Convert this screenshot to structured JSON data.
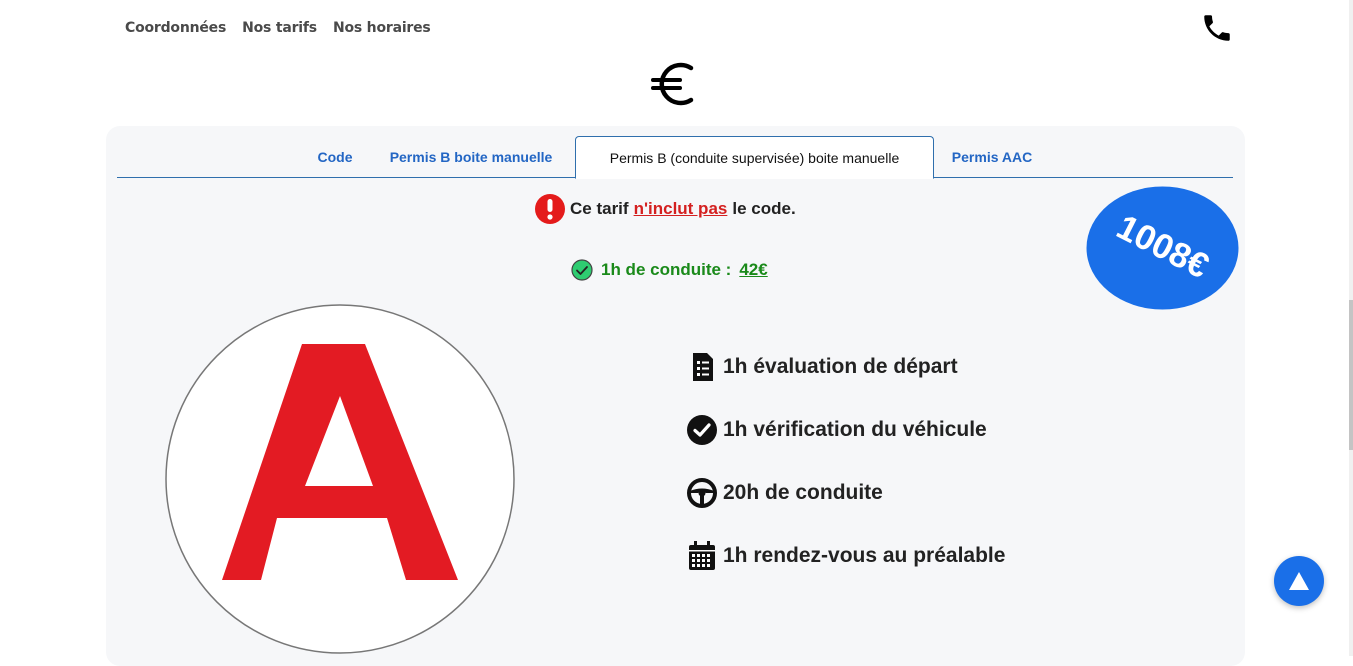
{
  "nav": {
    "items": [
      "Coordonnées",
      "Nos tarifs",
      "Nos horaires"
    ]
  },
  "header_icons": {
    "phone": "phone-icon",
    "euro": "euro-icon"
  },
  "tabs": [
    {
      "label": "Code",
      "active": false
    },
    {
      "label": "Permis B boite manuelle",
      "active": false
    },
    {
      "label": "Permis B (conduite supervisée) boite manuelle",
      "active": true
    },
    {
      "label": "Permis AAC",
      "active": false
    }
  ],
  "notice": {
    "pre": "Ce tarif",
    "highlight": "n'inclut pas",
    "post": "le code."
  },
  "hourly": {
    "label": "1h de conduite :",
    "price": "42€"
  },
  "price_badge": "1008€",
  "features": [
    {
      "icon": "checklist-icon",
      "label": "1h évaluation de départ"
    },
    {
      "icon": "check-circle-icon",
      "label": "1h vérification du véhicule"
    },
    {
      "icon": "steering-wheel-icon",
      "label": "20h de conduite"
    },
    {
      "icon": "calendar-icon",
      "label": "1h rendez-vous au préalable"
    }
  ],
  "sign_letter": "A",
  "colors": {
    "accent": "#1a6fe8",
    "tab_link": "#2366c4",
    "warning_red": "#d42020",
    "success_green": "#1a8a1a",
    "sign_red": "#e31b23"
  }
}
